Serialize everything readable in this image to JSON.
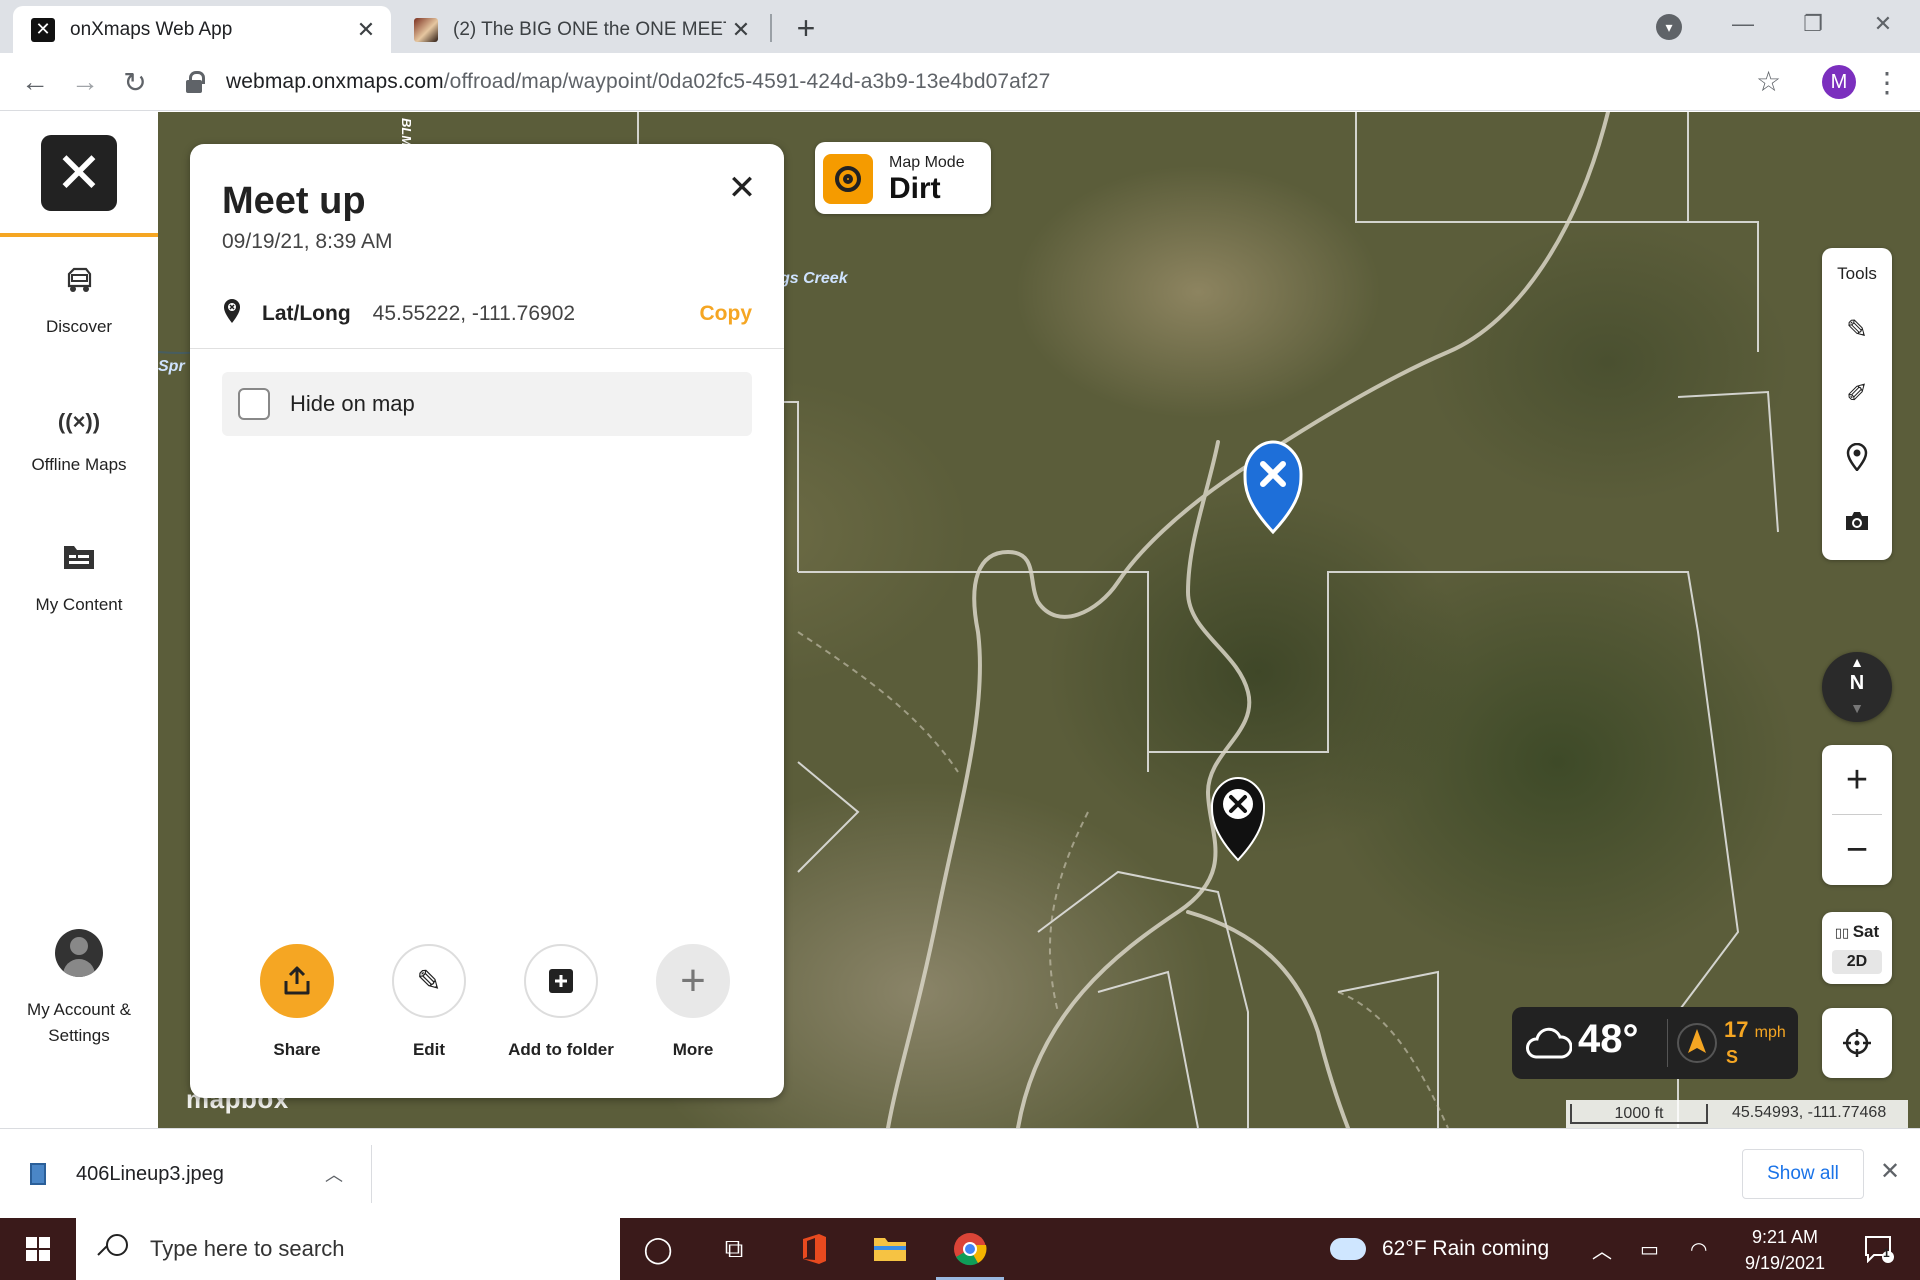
{
  "browser": {
    "tabs": [
      {
        "title": "onXmaps Web App",
        "icon": "onx-x-icon",
        "active": true
      },
      {
        "title": "(2) The BIG ONE the ONE MEETIN",
        "icon": "video-thumbnail-icon",
        "active": false
      }
    ],
    "url": {
      "host": "webmap.onxmaps.com",
      "path": "/offroad/map/waypoint/0da02fc5-4591-424d-a3b9-13e4bd07af27"
    },
    "profile_initial": "M"
  },
  "sidebar": {
    "items": [
      {
        "label": "Discover",
        "icon": "jeep-icon"
      },
      {
        "label": "Offline Maps",
        "icon": "offline-signal-icon"
      },
      {
        "label": "My Content",
        "icon": "folder-icon"
      }
    ],
    "account": {
      "line1": "My Account &",
      "line2": "Settings"
    }
  },
  "map": {
    "labels": {
      "creek": "gs Creek",
      "spring": "Spr",
      "blm": "BLM"
    },
    "attribution": "mapbox",
    "map_mode": {
      "caption": "Map Mode",
      "value": "Dirt"
    },
    "tools": {
      "title": "Tools",
      "items": [
        "pen-icon",
        "measure-icon",
        "pin-icon",
        "camera-icon"
      ]
    },
    "compass": {
      "label": "N"
    },
    "layer": {
      "name": "Sat",
      "view": "2D"
    },
    "weather": {
      "temp": "48°",
      "wind_speed": "17",
      "wind_unit": "mph",
      "wind_dir": "S"
    },
    "scale": {
      "distance": "1000 ft",
      "coords": "45.54993, -111.77468"
    }
  },
  "waypoint": {
    "title": "Meet up",
    "datetime": "09/19/21, 8:39 AM",
    "latlong_label": "Lat/Long",
    "latlong_value": "45.55222, -111.76902",
    "copy_label": "Copy",
    "hide_label": "Hide on map",
    "actions": [
      {
        "label": "Share",
        "icon": "share-icon"
      },
      {
        "label": "Edit",
        "icon": "pencil-icon"
      },
      {
        "label": "Add to folder",
        "icon": "add-folder-icon"
      },
      {
        "label": "More",
        "icon": "plus-icon"
      }
    ]
  },
  "downloads": {
    "file": "406Lineup3.jpeg",
    "show_all": "Show all"
  },
  "taskbar": {
    "search_placeholder": "Type here to search",
    "weather": "62°F  Rain coming",
    "time": "9:21 AM",
    "date": "9/19/2021",
    "notifications": "1"
  }
}
